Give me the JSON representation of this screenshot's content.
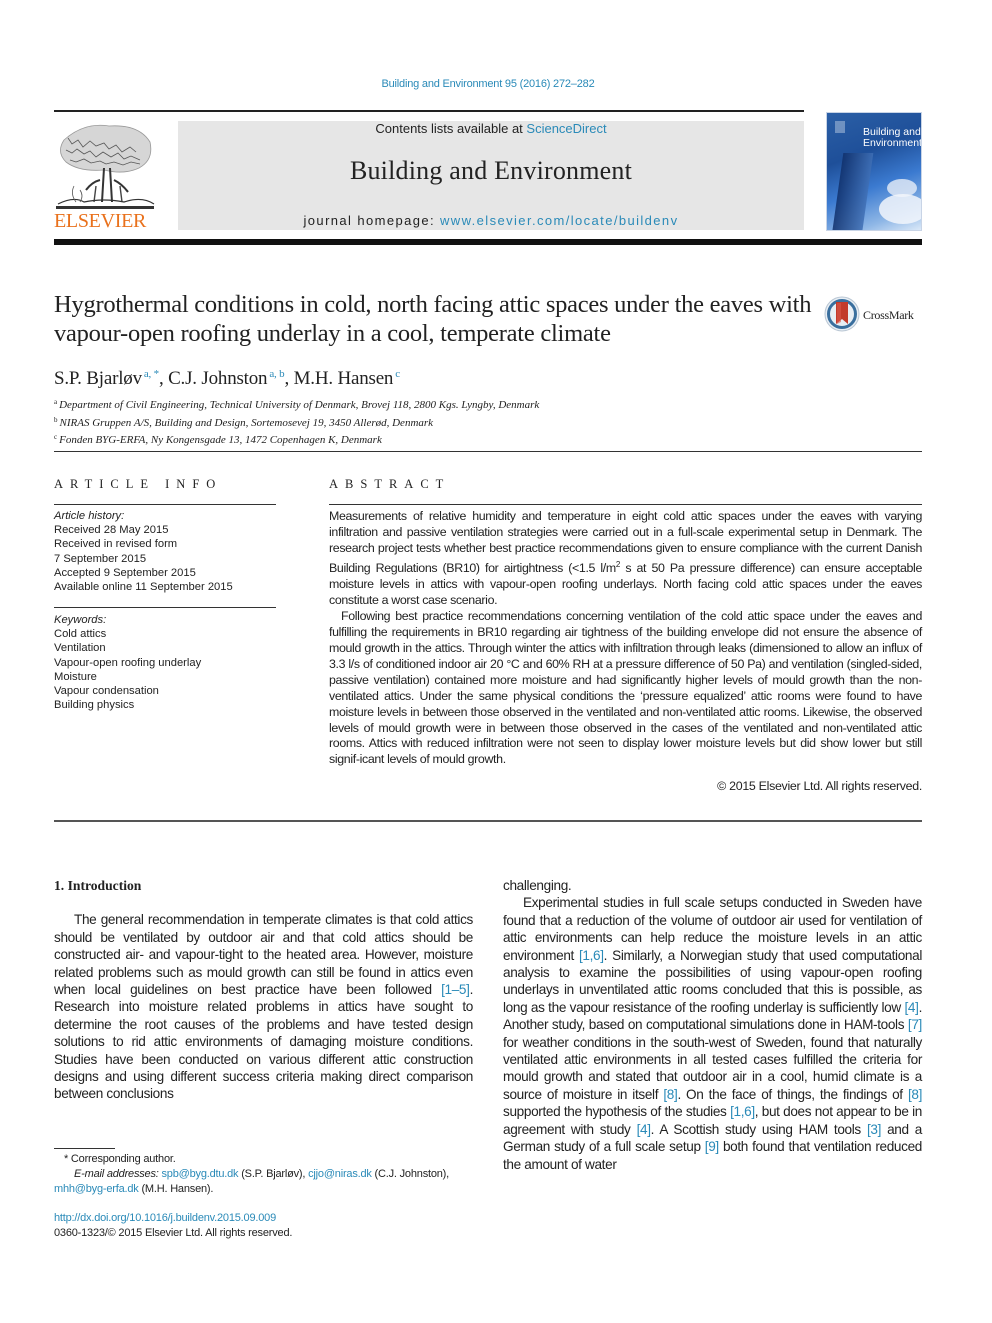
{
  "header": {
    "citation": "Building and Environment 95 (2016) 272–282",
    "contents_prefix": "Contents lists available at ",
    "contents_link": "ScienceDirect",
    "journal_title": "Building and Environment",
    "homepage_prefix": "journal homepage: ",
    "homepage_link": "www.elsevier.com/locate/buildenv",
    "publisher_logo_text": "ELSEVIER",
    "cover_title_line1": "Building and",
    "cover_title_line2": "Environment",
    "accent_color": "#2a8ab8",
    "publisher_color": "#e9711c"
  },
  "article": {
    "title": "Hygrothermal conditions in cold, north facing attic spaces under the eaves with vapour-open roofing underlay in a cool, temperate climate",
    "crossmark_label": "CrossMark",
    "authors": [
      {
        "name": "S.P. Bjarløv",
        "sup": "a, *",
        "sep": ", "
      },
      {
        "name": "C.J. Johnston",
        "sup": "a, b",
        "sep": ", "
      },
      {
        "name": "M.H. Hansen",
        "sup": "c",
        "sep": ""
      }
    ],
    "affiliations": [
      {
        "key": "a",
        "text": "Department of Civil Engineering, Technical University of Denmark, Brovej 118, 2800 Kgs. Lyngby, Denmark"
      },
      {
        "key": "b",
        "text": "NIRAS Gruppen A/S, Building and Design, Sortemosevej 19, 3450 Allerød, Denmark"
      },
      {
        "key": "c",
        "text": "Fonden BYG-ERFA, Ny Kongensgade 13, 1472 Copenhagen K, Denmark"
      }
    ]
  },
  "article_info": {
    "label": "ARTICLE INFO",
    "history_heading": "Article history:",
    "history": [
      "Received 28 May 2015",
      "Received in revised form",
      "7 September 2015",
      "Accepted 9 September 2015",
      "Available online 11 September 2015"
    ],
    "keywords_heading": "Keywords:",
    "keywords": [
      "Cold attics",
      "Ventilation",
      "Vapour-open roofing underlay",
      "Moisture",
      "Vapour condensation",
      "Building physics"
    ]
  },
  "abstract": {
    "label": "ABSTRACT",
    "p1_a": "Measurements of relative humidity and temperature in eight cold attic spaces under the eaves with varying infiltration and passive ventilation strategies were carried out in a full-scale experimental setup in Denmark. The research project tests whether best practice recommendations given to ensure compliance with the current Danish Building Regulations (BR10) for airtightness (<1.5 l/m",
    "p1_sup": "2",
    "p1_b": " s at 50 Pa pressure difference) can ensure acceptable moisture levels in attics with vapour-open roofing underlays. North facing cold attic spaces under the eaves constitute a worst case scenario.",
    "p2": "Following best practice recommendations concerning ventilation of the cold attic space under the eaves and fulfilling the requirements in BR10 regarding air tightness of the building envelope did not ensure the absence of mould growth in the attics. Through winter the attics with infiltration through leaks (dimensioned to allow an influx of 3.3 l/s of conditioned indoor air 20 °C and 60% RH at a pressure difference of 50 Pa) and ventilation (singled-sided, passive ventilation) contained more moisture and had significantly higher levels of mould growth than the non-ventilated attics. Under the same physical conditions the ‘pressure equalized’ attic rooms were found to have moisture levels in between those observed in the ventilated and non-ventilated attic rooms. Likewise, the observed levels of mould growth were in between those observed in the cases of the ventilated and non-ventilated attic rooms. Attics with reduced infiltration were not seen to display lower moisture levels but did show lower but still signif-icant levels of mould growth.",
    "copyright": "© 2015 Elsevier Ltd. All rights reserved."
  },
  "body": {
    "intro_heading": "1.  Introduction",
    "left_p1_a": "The general recommendation in temperate climates is that cold attics should be ventilated by outdoor air and that cold attics should be constructed air- and vapour-tight to the heated area. However, moisture related problems such as mould growth can still be found in attics even when local guidelines on best practice have been followed ",
    "left_ref1": "[1–5]",
    "left_p1_b": ". Research into moisture related problems in attics have sought to determine the root causes of the problems and have tested design solutions to rid attic environments of damaging moisture conditions. Studies have been conducted on various different attic construction designs and using different success criteria making direct comparison between conclusions",
    "right_cont": "challenging.",
    "right_p2": [
      {
        "t": "Experimental studies in full scale setups conducted in Sweden have found that a reduction of the volume of outdoor air used for ventilation of attic environments can help reduce the moisture levels in an attic environment ",
        "ref": false
      },
      {
        "t": "[1,6]",
        "ref": true
      },
      {
        "t": ". Similarly, a Norwegian study that used computational analysis to examine the possibilities of using vapour-open roofing underlays in unventilated attic rooms concluded that this is possible, as long as the vapour resistance of the roofing underlay is sufficiently low ",
        "ref": false
      },
      {
        "t": "[4]",
        "ref": true
      },
      {
        "t": ". Another study, based on computational simulations done in HAM-tools ",
        "ref": false
      },
      {
        "t": "[7]",
        "ref": true
      },
      {
        "t": " for weather conditions in the south-west of Sweden, found that naturally ventilated attic environments in all tested cases fulfilled the criteria for mould growth and stated that outdoor air in a cool, humid climate is a source of moisture in itself ",
        "ref": false
      },
      {
        "t": "[8]",
        "ref": true
      },
      {
        "t": ". On the face of things, the findings of ",
        "ref": false
      },
      {
        "t": "[8]",
        "ref": true
      },
      {
        "t": " supported the hypothesis of the studies ",
        "ref": false
      },
      {
        "t": "[1,6]",
        "ref": true
      },
      {
        "t": ", but does not appear to be in agreement with study ",
        "ref": false
      },
      {
        "t": "[4]",
        "ref": true
      },
      {
        "t": ". A Scottish study using HAM tools ",
        "ref": false
      },
      {
        "t": "[3]",
        "ref": true
      },
      {
        "t": " and a German study of a full scale setup ",
        "ref": false
      },
      {
        "t": "[9]",
        "ref": true
      },
      {
        "t": " both found that ventilation reduced the amount of water",
        "ref": false
      }
    ]
  },
  "footnotes": {
    "corresponding": "* Corresponding author.",
    "email_label": "E-mail addresses: ",
    "emails": [
      {
        "addr": "spb@byg.dtu.dk",
        "who": " (S.P. Bjarløv), "
      },
      {
        "addr": "cjjo@niras.dk",
        "who": " (C.J. Johnston), "
      },
      {
        "addr": "mhh@byg-erfa.dk",
        "who": " (M.H. Hansen)."
      }
    ],
    "doi": "http://dx.doi.org/10.1016/j.buildenv.2015.09.009",
    "issn_copyright": "0360-1323/© 2015 Elsevier Ltd. All rights reserved."
  }
}
